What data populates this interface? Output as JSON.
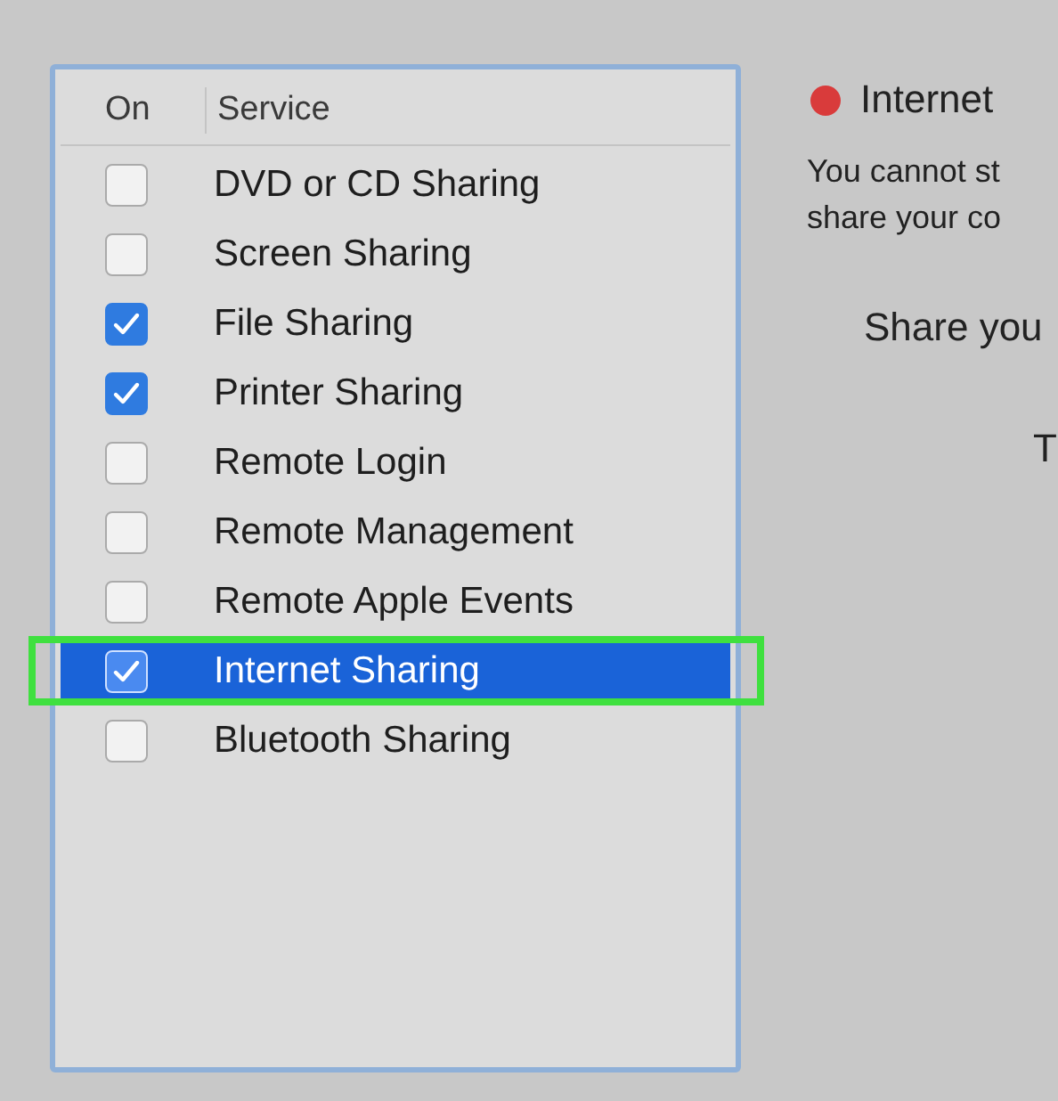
{
  "services_table": {
    "columns": [
      "On",
      "Service"
    ],
    "rows": [
      {
        "name": "DVD or CD Sharing",
        "checked": false,
        "selected": false,
        "highlighted": false
      },
      {
        "name": "Screen Sharing",
        "checked": false,
        "selected": false,
        "highlighted": false
      },
      {
        "name": "File Sharing",
        "checked": true,
        "selected": false,
        "highlighted": false
      },
      {
        "name": "Printer Sharing",
        "checked": true,
        "selected": false,
        "highlighted": false
      },
      {
        "name": "Remote Login",
        "checked": false,
        "selected": false,
        "highlighted": false
      },
      {
        "name": "Remote Management",
        "checked": false,
        "selected": false,
        "highlighted": false
      },
      {
        "name": "Remote Apple Events",
        "checked": false,
        "selected": false,
        "highlighted": false
      },
      {
        "name": "Internet Sharing",
        "checked": true,
        "selected": true,
        "highlighted": true
      },
      {
        "name": "Bluetooth Sharing",
        "checked": false,
        "selected": false,
        "highlighted": false
      }
    ]
  },
  "detail": {
    "active": false,
    "title": "Internet",
    "description_lines": [
      "You cannot st",
      "share your co"
    ],
    "share_label": "Share you",
    "cut_label": "T"
  }
}
